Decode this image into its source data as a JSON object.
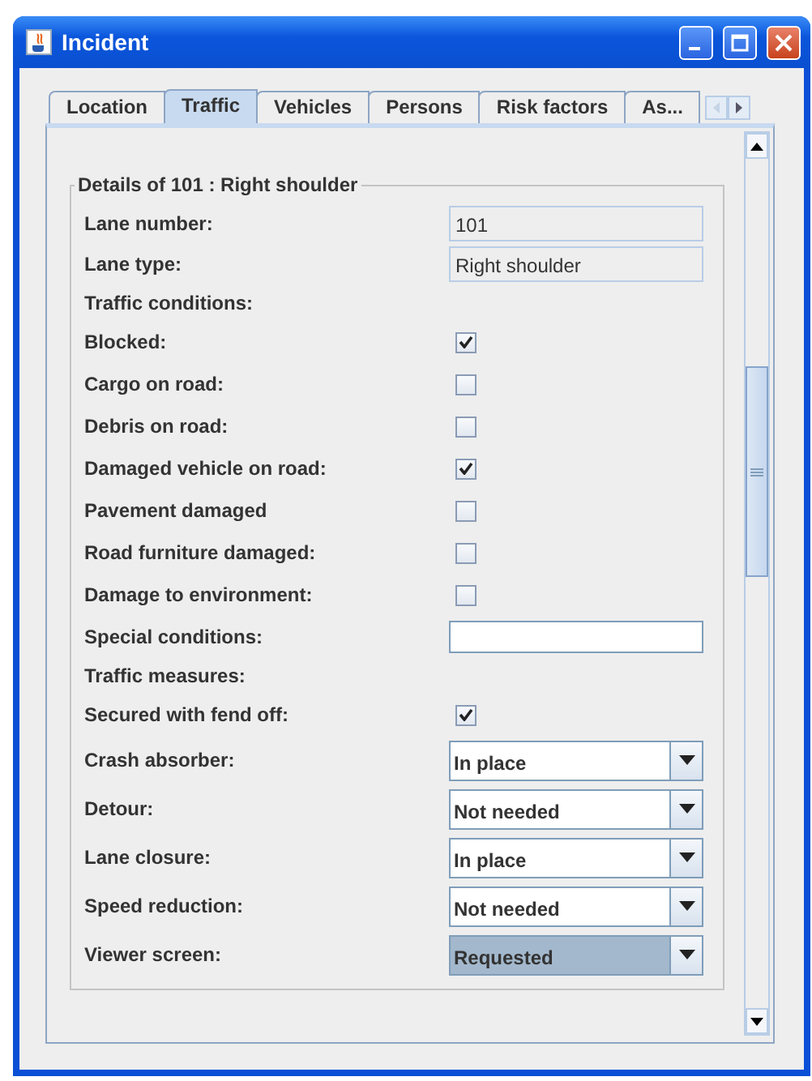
{
  "window": {
    "title": "Incident"
  },
  "tabs": [
    {
      "label": "Location",
      "selected": false
    },
    {
      "label": "Traffic",
      "selected": true
    },
    {
      "label": "Vehicles",
      "selected": false
    },
    {
      "label": "Persons",
      "selected": false
    },
    {
      "label": "Risk factors",
      "selected": false
    },
    {
      "label": "As...",
      "selected": false
    }
  ],
  "group": {
    "title": "Details of 101 : Right shoulder"
  },
  "rows": [
    {
      "kind": "readonly",
      "label": "Lane number:",
      "value": "101"
    },
    {
      "kind": "readonly",
      "label": "Lane type:",
      "value": "Right shoulder"
    },
    {
      "kind": "heading",
      "label": "Traffic conditions:"
    },
    {
      "kind": "checkbox",
      "label": "Blocked:",
      "checked": true
    },
    {
      "kind": "checkbox",
      "label": "Cargo on road:",
      "checked": false
    },
    {
      "kind": "checkbox",
      "label": "Debris on road:",
      "checked": false
    },
    {
      "kind": "checkbox",
      "label": "Damaged vehicle on road:",
      "checked": true
    },
    {
      "kind": "checkbox",
      "label": "Pavement damaged",
      "checked": false
    },
    {
      "kind": "checkbox",
      "label": "Road furniture damaged:",
      "checked": false
    },
    {
      "kind": "checkbox",
      "label": "Damage to environment:",
      "checked": false
    },
    {
      "kind": "input",
      "label": "Special conditions:"
    },
    {
      "kind": "heading",
      "label": "Traffic measures:"
    },
    {
      "kind": "checkbox",
      "label": "Secured with fend off:",
      "checked": true
    },
    {
      "kind": "combo",
      "label": "Crash absorber:",
      "value": "In place",
      "focused": false
    },
    {
      "kind": "combo",
      "label": "Detour:",
      "value": "Not needed",
      "focused": false
    },
    {
      "kind": "combo",
      "label": "Lane closure:",
      "value": "In place",
      "focused": false
    },
    {
      "kind": "combo",
      "label": "Speed reduction:",
      "value": "Not needed",
      "focused": false
    },
    {
      "kind": "combo",
      "label": "Viewer screen:",
      "value": "Requested",
      "focused": true
    }
  ]
}
